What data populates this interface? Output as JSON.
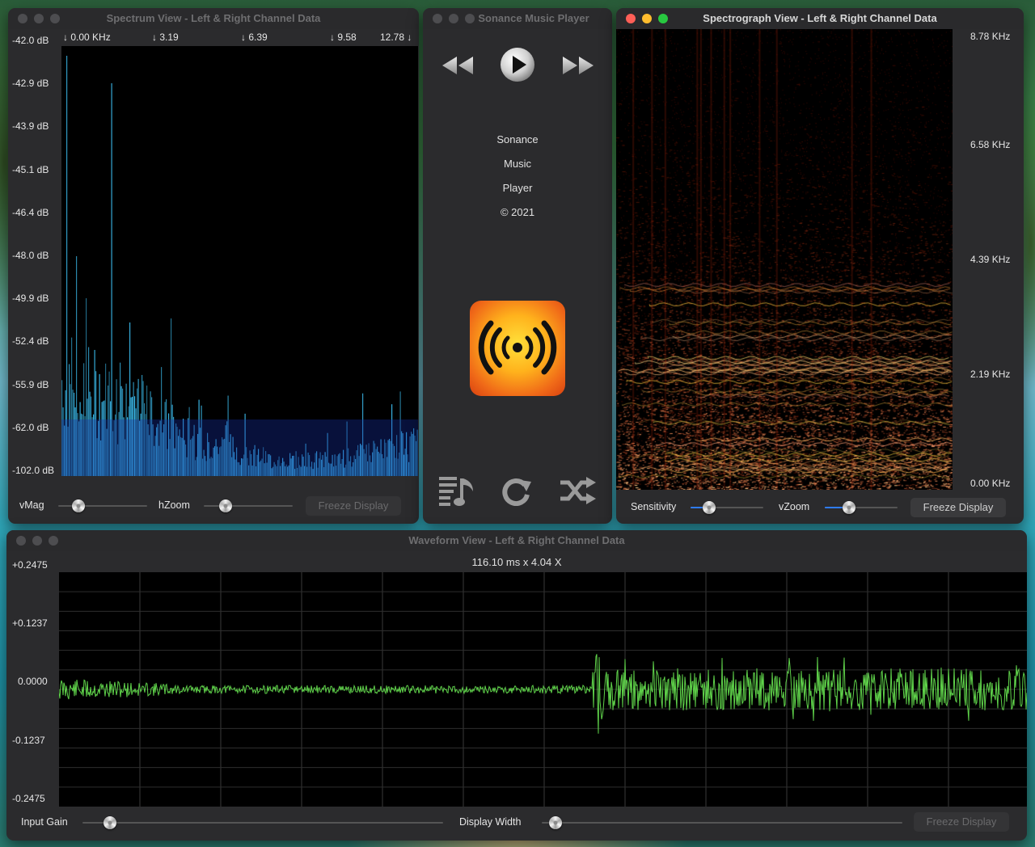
{
  "spectrum": {
    "title": "Spectrum View - Left & Right Channel Data",
    "db_labels": [
      "-42.0 dB",
      "-42.9 dB",
      "-43.9 dB",
      "-45.1 dB",
      "-46.4 dB",
      "-48.0 dB",
      "-49.9 dB",
      "-52.4 dB",
      "-55.9 dB",
      "-62.0 dB",
      "-102.0 dB"
    ],
    "freq_labels": [
      "↓ 0.00 KHz",
      "↓ 3.19",
      "↓ 6.39",
      "↓ 9.58",
      "12.78 ↓"
    ],
    "vmag_label": "vMag",
    "hzoom_label": "hZoom",
    "freeze_label": "Freeze Display",
    "vmag_level": 0.18,
    "hzoom_level": 0.2,
    "bar_color": "#39b6e6"
  },
  "player": {
    "title": "Sonance Music Player",
    "about_lines": [
      "Sonance",
      "Music",
      "Player",
      "© 2021"
    ],
    "icons": {
      "rewind": "rewind-icon",
      "play": "play-icon",
      "forward": "fast-forward-icon",
      "playlist": "playlist-icon",
      "repeat": "repeat-icon",
      "shuffle": "shuffle-icon",
      "app": "broadcast-icon"
    },
    "accent": "#f08a1a"
  },
  "spectrograph": {
    "title": "Spectrograph View - Left & Right Channel Data",
    "freq_labels": [
      "8.78 KHz",
      "6.58 KHz",
      "4.39 KHz",
      "2.19 KHz",
      "0.00 KHz"
    ],
    "sensitivity_label": "Sensitivity",
    "vzoom_label": "vZoom",
    "freeze_label": "Freeze Display",
    "sensitivity_level": 0.2,
    "vzoom_level": 0.3,
    "heat_color": "#ff5a10"
  },
  "waveform": {
    "title": "Waveform View - Left & Right Channel Data",
    "readout": "116.10 ms x 4.04 X",
    "amp_labels": [
      "+0.2475",
      "+0.1237",
      "0.0000",
      "-0.1237",
      "-0.2475"
    ],
    "input_gain_label": "Input Gain",
    "display_width_label": "Display Width",
    "freeze_label": "Freeze Display",
    "input_gain_level": 0.06,
    "display_width_level": 0.02,
    "wave_color": "#5fd24a"
  }
}
